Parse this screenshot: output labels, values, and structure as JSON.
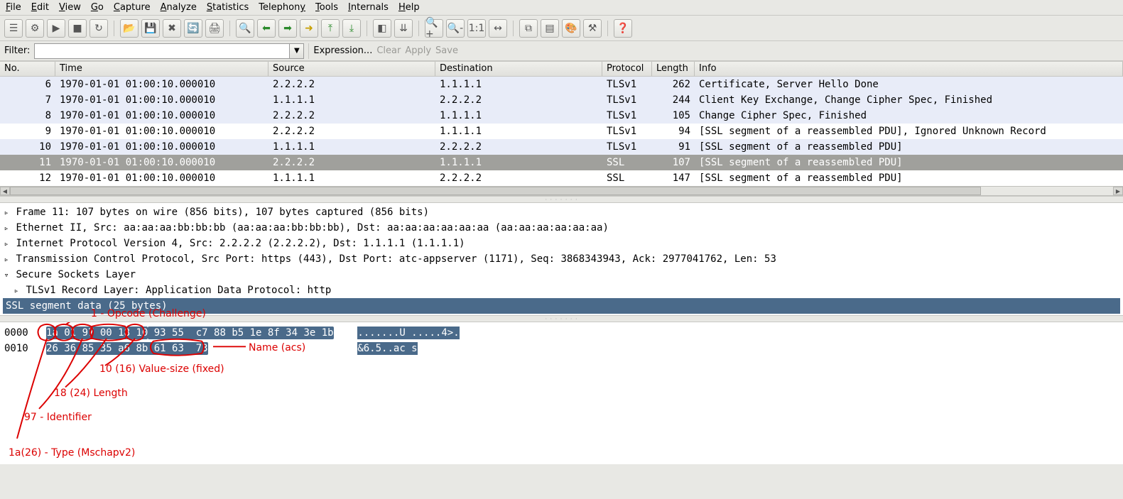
{
  "menu": {
    "items": [
      {
        "pre": "",
        "ul": "F",
        "post": "ile"
      },
      {
        "pre": "",
        "ul": "E",
        "post": "dit"
      },
      {
        "pre": "",
        "ul": "V",
        "post": "iew"
      },
      {
        "pre": "",
        "ul": "G",
        "post": "o"
      },
      {
        "pre": "",
        "ul": "C",
        "post": "apture"
      },
      {
        "pre": "",
        "ul": "A",
        "post": "nalyze"
      },
      {
        "pre": "",
        "ul": "S",
        "post": "tatistics"
      },
      {
        "pre": "Telephon",
        "ul": "y",
        "post": ""
      },
      {
        "pre": "",
        "ul": "T",
        "post": "ools"
      },
      {
        "pre": "",
        "ul": "I",
        "post": "nternals"
      },
      {
        "pre": "",
        "ul": "H",
        "post": "elp"
      }
    ]
  },
  "toolbar_icons": [
    "list-interfaces",
    "capture-options",
    "start-capture",
    "stop-capture",
    "restart-capture",
    "open-file",
    "save-file",
    "close-file",
    "reload",
    "print",
    "find",
    "go-back",
    "go-forward",
    "go-to-packet",
    "go-first",
    "go-last",
    "colorize",
    "auto-scroll",
    "zoom-in",
    "zoom-out",
    "zoom-reset",
    "resize-cols",
    "capture-filters",
    "display-filters",
    "coloring-rules",
    "preferences",
    "help"
  ],
  "filter": {
    "label": "Filter:",
    "value": "",
    "expression": "Expression...",
    "clear": "Clear",
    "apply": "Apply",
    "save": "Save"
  },
  "packet_list": {
    "columns": [
      "No.",
      "Time",
      "Source",
      "Destination",
      "Protocol",
      "Length",
      "Info"
    ],
    "rows": [
      {
        "no": "6",
        "time": "1970-01-01 01:00:10.000010",
        "src": "2.2.2.2",
        "dst": "1.1.1.1",
        "proto": "TLSv1",
        "len": "262",
        "info": "Certificate, Server Hello Done",
        "cls": "row-light"
      },
      {
        "no": "7",
        "time": "1970-01-01 01:00:10.000010",
        "src": "1.1.1.1",
        "dst": "2.2.2.2",
        "proto": "TLSv1",
        "len": "244",
        "info": "Client Key Exchange, Change Cipher Spec, Finished",
        "cls": "row-light"
      },
      {
        "no": "8",
        "time": "1970-01-01 01:00:10.000010",
        "src": "2.2.2.2",
        "dst": "1.1.1.1",
        "proto": "TLSv1",
        "len": "105",
        "info": "Change Cipher Spec, Finished",
        "cls": "row-light"
      },
      {
        "no": "9",
        "time": "1970-01-01 01:00:10.000010",
        "src": "2.2.2.2",
        "dst": "1.1.1.1",
        "proto": "TLSv1",
        "len": "94",
        "info": "[SSL segment of a reassembled PDU], Ignored Unknown Record",
        "cls": "row-white"
      },
      {
        "no": "10",
        "time": "1970-01-01 01:00:10.000010",
        "src": "1.1.1.1",
        "dst": "2.2.2.2",
        "proto": "TLSv1",
        "len": "91",
        "info": "[SSL segment of a reassembled PDU]",
        "cls": "row-light"
      },
      {
        "no": "11",
        "time": "1970-01-01 01:00:10.000010",
        "src": "2.2.2.2",
        "dst": "1.1.1.1",
        "proto": "SSL",
        "len": "107",
        "info": "[SSL segment of a reassembled PDU]",
        "cls": "row-selected"
      },
      {
        "no": "12",
        "time": "1970-01-01 01:00:10.000010",
        "src": "1.1.1.1",
        "dst": "2.2.2.2",
        "proto": "SSL",
        "len": "147",
        "info": "[SSL segment of a reassembled PDU]",
        "cls": "row-white"
      }
    ]
  },
  "details": {
    "frame": "Frame 11: 107 bytes on wire (856 bits), 107 bytes captured (856 bits)",
    "eth": "Ethernet II, Src: aa:aa:aa:bb:bb:bb (aa:aa:aa:bb:bb:bb), Dst: aa:aa:aa:aa:aa:aa (aa:aa:aa:aa:aa:aa)",
    "ip": "Internet Protocol Version 4, Src: 2.2.2.2 (2.2.2.2), Dst: 1.1.1.1 (1.1.1.1)",
    "tcp": "Transmission Control Protocol, Src Port: https (443), Dst Port: atc-appserver (1171), Seq: 3868343943, Ack: 2977041762, Len: 53",
    "ssl": "Secure Sockets Layer",
    "tls_rec": "TLSv1 Record Layer: Application Data Protocol: http",
    "ssl_seg": "SSL segment data (25 bytes)"
  },
  "hex": {
    "line0": {
      "offset": "0000",
      "sel_bytes": "1a 01 97 00 18 10",
      "rest_bytes": " 93 55  c7 88 b5 1e 8f 34 3e 1b",
      "ascii_sel": ".......U .....4>.",
      "ascii_rest": ""
    },
    "line1": {
      "offset": "0010",
      "sel_bytes": "26 36 85 35 a6 8b 61 63  73",
      "rest_bytes": "",
      "ascii_sel1": "&6.5..ac s",
      "ascii_rest": ""
    }
  },
  "annotations": {
    "opcode": "1 - Opcode (Challenge)",
    "name": "Name (acs)",
    "valuesize": "10 (16) Value-size (fixed)",
    "length": "18 (24) Length",
    "identifier": "97 - Identifier",
    "type": "1a(26) - Type (Mschapv2)"
  }
}
